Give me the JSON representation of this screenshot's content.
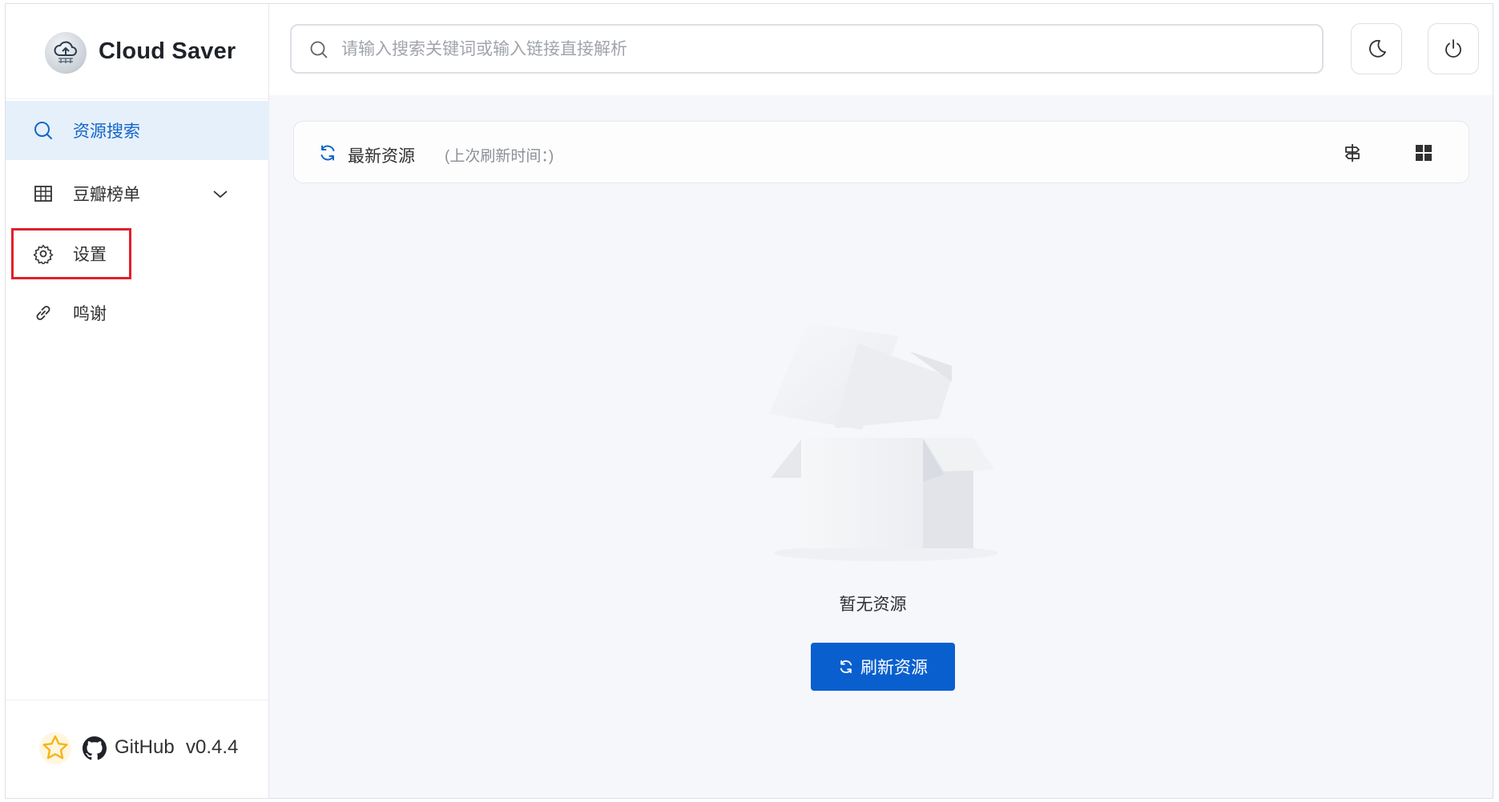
{
  "app": {
    "title": "Cloud Saver",
    "logo_icon": "cloud-upload-icon"
  },
  "sidebar": {
    "items": [
      {
        "label": "资源搜索",
        "icon": "search-icon",
        "active": true
      },
      {
        "label": "豆瓣榜单",
        "icon": "grid-table-icon",
        "expandable": true
      },
      {
        "label": "设置",
        "icon": "gear-icon",
        "highlighted": true
      },
      {
        "label": "鸣谢",
        "icon": "link-icon"
      }
    ],
    "footer": {
      "github_label": "GitHub",
      "version": "v0.4.4"
    }
  },
  "header": {
    "search_placeholder": "请输入搜索关键词或输入链接直接解析",
    "theme_button_icon": "moon-icon",
    "power_button_icon": "power-icon"
  },
  "main": {
    "resource_bar": {
      "title": "最新资源",
      "subtitle": "(上次刷新时间：)"
    },
    "empty_text": "暂无资源",
    "refresh_button_label": "刷新资源"
  },
  "colors": {
    "accent": "#0a5fcf",
    "active_bg": "#e6f0fb",
    "active_text": "#1366c9",
    "highlight": "#e0202a"
  }
}
